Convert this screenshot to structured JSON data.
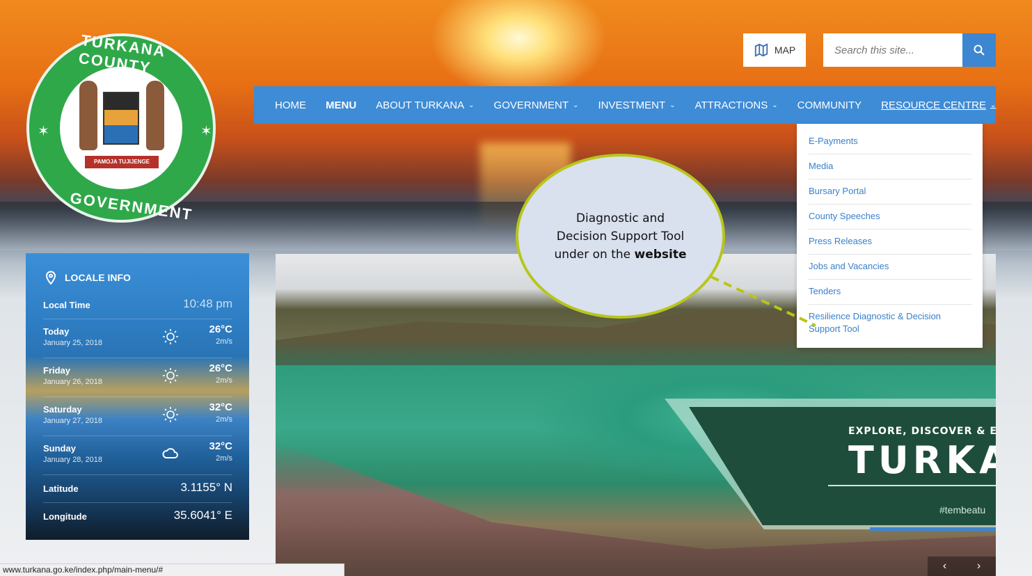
{
  "logo": {
    "top_text": "TURKANA COUNTY",
    "bottom_text": "GOVERNMENT",
    "motto": "PAMOJA TUJIJENGE"
  },
  "header": {
    "map_label": "MAP",
    "search_placeholder": "Search this site..."
  },
  "nav": {
    "items": [
      {
        "label": "HOME"
      },
      {
        "label": "MENU"
      },
      {
        "label": "ABOUT TURKANA"
      },
      {
        "label": "GOVERNMENT"
      },
      {
        "label": "INVESTMENT"
      },
      {
        "label": "ATTRACTIONS"
      },
      {
        "label": "COMMUNITY"
      },
      {
        "label": "RESOURCE CENTRE"
      }
    ]
  },
  "dropdown": {
    "items": [
      "E-Payments",
      "Media",
      "Bursary Portal",
      "County Speeches",
      "Press Releases",
      "Jobs and Vacancies",
      "Tenders",
      "Resilience Diagnostic & Decision Support Tool"
    ]
  },
  "locale": {
    "title": "LOCALE INFO",
    "local_time_label": "Local Time",
    "local_time_value": "10:48 pm",
    "days": [
      {
        "day": "Today",
        "date": "January 25, 2018",
        "temp": "26°C",
        "wind": "2m/s",
        "icon": "sun-icon"
      },
      {
        "day": "Friday",
        "date": "January 26, 2018",
        "temp": "26°C",
        "wind": "2m/s",
        "icon": "sun-icon"
      },
      {
        "day": "Saturday",
        "date": "January 27, 2018",
        "temp": "32°C",
        "wind": "2m/s",
        "icon": "sun-icon"
      },
      {
        "day": "Sunday",
        "date": "January 28, 2018",
        "temp": "32°C",
        "wind": "2m/s",
        "icon": "cloud-icon"
      }
    ],
    "latitude_label": "Latitude",
    "latitude_value": "3.1155° N",
    "longitude_label": "Longitude",
    "longitude_value": "35.6041° E"
  },
  "banner": {
    "subtitle": "EXPLORE, DISCOVER & EXPERI",
    "title": "TURKAN",
    "tag": "#tembeatu"
  },
  "callout": {
    "line1": "Diagnostic and",
    "line2": "Decision Support Tool",
    "line3_prefix": "under on the ",
    "line3_bold": "website"
  },
  "status": {
    "url": "www.turkana.go.ke/index.php/main-menu/#"
  },
  "colors": {
    "nav_blue": "#3e8bd6",
    "link_blue": "#3a7fc9",
    "logo_green": "#2fa84a",
    "callout_border": "#b7c61a",
    "callout_fill": "#d9e0ee"
  }
}
